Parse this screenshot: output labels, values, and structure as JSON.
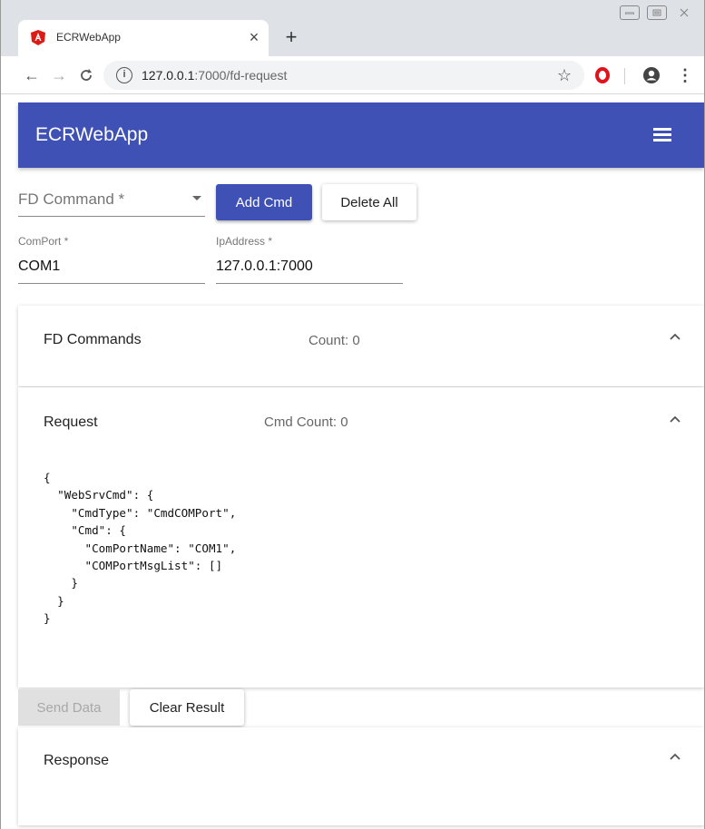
{
  "browser": {
    "tab_title": "ECRWebApp",
    "tab_close": "×",
    "new_tab": "+",
    "url_host": "127.0.0.1",
    "url_rest": ":7000/fd-request",
    "back": "←",
    "forward": "→",
    "reload": "C",
    "star": "☆",
    "menu": "⋮",
    "info": "i"
  },
  "app": {
    "title": "ECRWebApp",
    "brand_color": "#3f51b5"
  },
  "form": {
    "fd_command_placeholder": "FD Command *",
    "add_cmd_label": "Add Cmd",
    "delete_all_label": "Delete All",
    "comport_label": "ComPort *",
    "comport_value": "COM1",
    "ipaddress_label": "IpAddress *",
    "ipaddress_value": "127.0.0.1:7000"
  },
  "panels": {
    "fd_commands": {
      "title": "FD Commands",
      "count": "Count: 0"
    },
    "request": {
      "title": "Request",
      "count": "Cmd Count: 0",
      "json": "{\n  \"WebSrvCmd\": {\n    \"CmdType\": \"CmdCOMPort\",\n    \"Cmd\": {\n      \"ComPortName\": \"COM1\",\n      \"COMPortMsgList\": []\n    }\n  }\n}"
    },
    "response": {
      "title": "Response"
    }
  },
  "actions": {
    "send_data_label": "Send Data",
    "clear_result_label": "Clear Result"
  }
}
